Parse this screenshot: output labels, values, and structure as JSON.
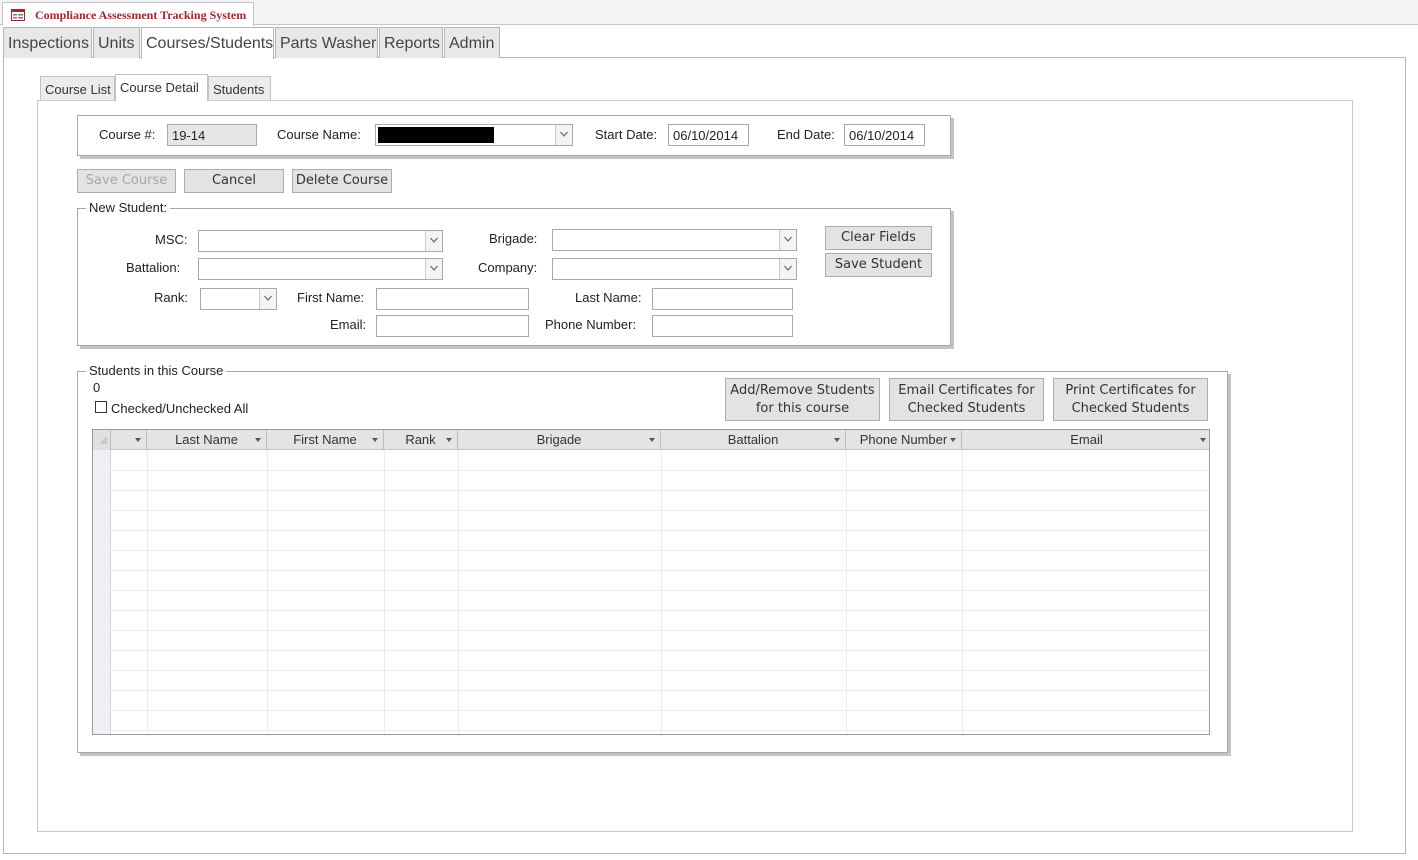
{
  "app": {
    "title": "Compliance Assessment Tracking System"
  },
  "main_tabs": [
    {
      "label": "Inspections"
    },
    {
      "label": "Units"
    },
    {
      "label": "Courses/Students"
    },
    {
      "label": "Parts Washer"
    },
    {
      "label": "Reports"
    },
    {
      "label": "Admin"
    }
  ],
  "sub_tabs": [
    {
      "label": "Course List"
    },
    {
      "label": "Course Detail"
    },
    {
      "label": "Students"
    }
  ],
  "course": {
    "number_label": "Course #:",
    "number_value": "19-14",
    "name_label": "Course Name:",
    "name_value": "",
    "start_label": "Start Date:",
    "start_value": "06/10/2014",
    "end_label": "End Date:",
    "end_value": "06/10/2014"
  },
  "course_actions": {
    "save": "Save Course",
    "cancel": "Cancel",
    "delete": "Delete Course"
  },
  "new_student": {
    "legend": "New Student:",
    "msc_label": "MSC:",
    "brigade_label": "Brigade:",
    "battalion_label": "Battalion:",
    "company_label": "Company:",
    "rank_label": "Rank:",
    "first_name_label": "First Name:",
    "last_name_label": "Last Name:",
    "email_label": "Email:",
    "phone_label": "Phone Number:",
    "msc_value": "",
    "brigade_value": "",
    "battalion_value": "",
    "company_value": "",
    "rank_value": "",
    "first_name_value": "",
    "last_name_value": "",
    "email_value": "",
    "phone_value": "",
    "clear_button": "Clear Fields",
    "save_button": "Save Student"
  },
  "students_section": {
    "legend": "Students in this Course",
    "count": "0",
    "check_all_label": "Checked/Unchecked All",
    "add_remove_button": "Add/Remove Students for this course",
    "email_cert_button": "Email Certificates for Checked Students",
    "print_cert_button": "Print Certificates for Checked Students",
    "columns": [
      "Last Name",
      "First Name",
      "Rank",
      "Brigade",
      "Battalion",
      "Phone Number",
      "Email"
    ]
  },
  "colors": {
    "title_red": "#a4262c",
    "redacted": "#000000"
  },
  "icons": {
    "app": "form-icon",
    "dropdown": "chevron-down-icon",
    "sort": "sort-arrow-icon"
  }
}
